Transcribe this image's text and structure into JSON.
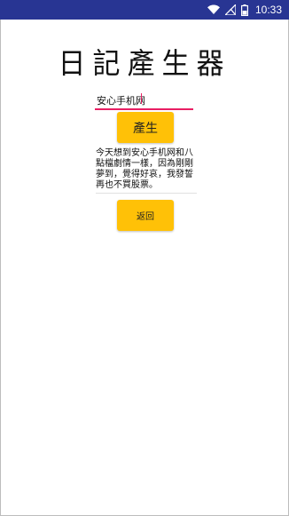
{
  "status_bar": {
    "time": "10:33",
    "background_color": "#283593",
    "icons": [
      "wifi-icon",
      "no-signal-icon",
      "battery-icon"
    ]
  },
  "app": {
    "title": "日記產生器"
  },
  "input": {
    "value": "安心手机网",
    "underline_color": "#e91e63"
  },
  "buttons": {
    "generate_label": "產生",
    "back_label": "返回",
    "color": "#ffc107"
  },
  "output": {
    "diary_text": "今天想到安心手机网和八點檔劇情一樣，因為剛剛夢到，覺得好哀，我發誓再也不買股票。"
  }
}
